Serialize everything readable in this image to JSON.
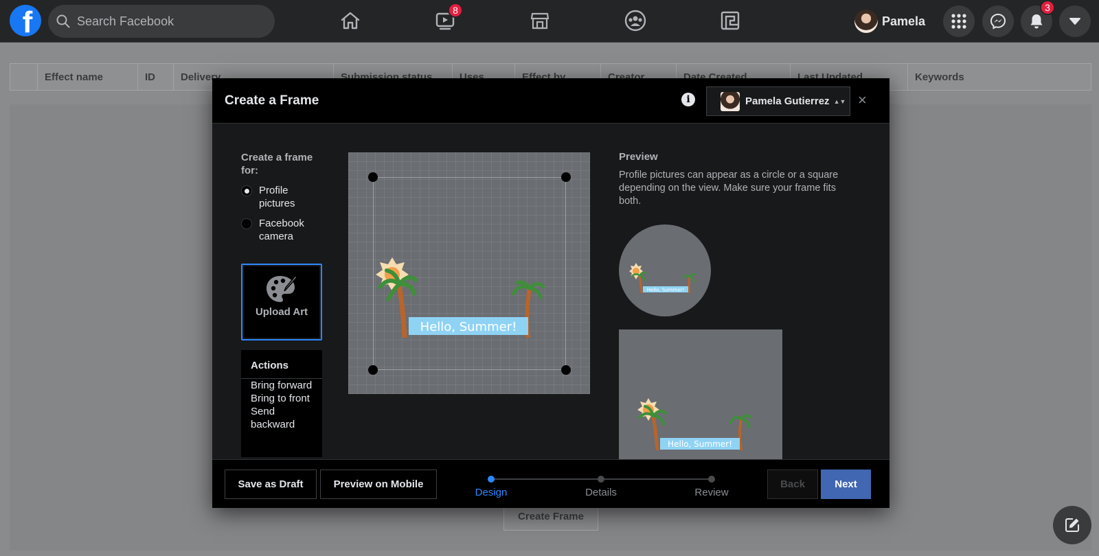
{
  "nav": {
    "search_placeholder": "Search Facebook",
    "logo_letter": "f",
    "watch_badge": "8",
    "profile_name": "Pamela",
    "notifications_badge": "3",
    "accent": "#1877f2",
    "badge_color": "#e41e3f"
  },
  "background_page": {
    "columns": [
      "",
      "Effect name",
      "ID",
      "Delivery",
      "Submission status",
      "Uses",
      "Effect by",
      "Creator",
      "Date Created",
      "Last Updated",
      "Keywords"
    ],
    "create_frame_label": "Create Frame"
  },
  "modal": {
    "title": "Create a Frame",
    "info_glyph": "i",
    "account_name": "Pamela Gutierrez",
    "close_glyph": "×",
    "create_for_label": "Create a frame for:",
    "options": [
      {
        "label": "Profile pictures",
        "checked": true
      },
      {
        "label": "Facebook camera",
        "checked": false
      }
    ],
    "upload_art_label": "Upload Art",
    "actions": {
      "title": "Actions",
      "items": [
        "Bring forward",
        "Bring to front",
        "Send backward"
      ]
    },
    "art_text": "Hello, Summer!",
    "preview": {
      "title": "Preview",
      "description": "Profile pictures can appear as a circle or a square depending on the view. Make sure your frame fits both."
    },
    "footer": {
      "save_draft": "Save as Draft",
      "preview_mobile": "Preview on Mobile",
      "steps": [
        "Design",
        "Details",
        "Review"
      ],
      "active_step": 0,
      "back": "Back",
      "next": "Next"
    }
  }
}
